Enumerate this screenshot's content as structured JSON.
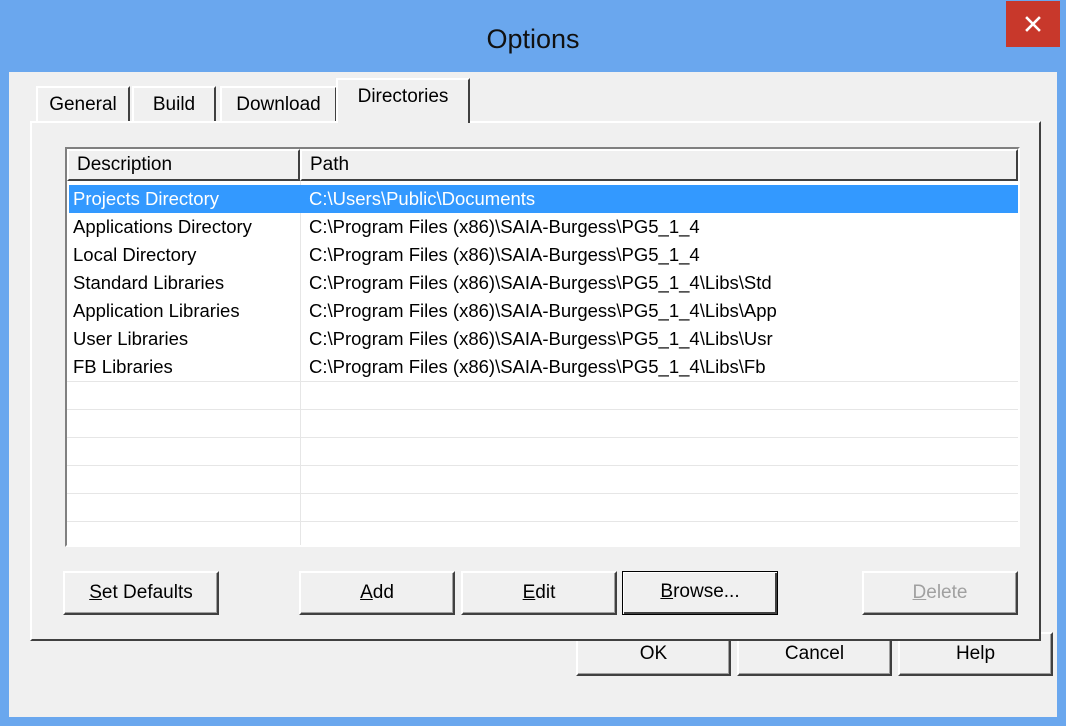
{
  "window": {
    "title": "Options"
  },
  "tabs": [
    {
      "label": "General"
    },
    {
      "label": "Build"
    },
    {
      "label": "Download"
    },
    {
      "label": "Directories",
      "active": true
    }
  ],
  "list": {
    "columns": [
      {
        "label": "Description"
      },
      {
        "label": "Path"
      }
    ],
    "rows": [
      {
        "description": "Projects Directory",
        "path": "C:\\Users\\Public\\Documents",
        "selected": true
      },
      {
        "description": "Applications Directory",
        "path": "C:\\Program Files (x86)\\SAIA-Burgess\\PG5_1_4"
      },
      {
        "description": "Local Directory",
        "path": "C:\\Program Files (x86)\\SAIA-Burgess\\PG5_1_4"
      },
      {
        "description": "Standard Libraries",
        "path": "C:\\Program Files (x86)\\SAIA-Burgess\\PG5_1_4\\Libs\\Std"
      },
      {
        "description": "Application Libraries",
        "path": "C:\\Program Files (x86)\\SAIA-Burgess\\PG5_1_4\\Libs\\App"
      },
      {
        "description": "User Libraries",
        "path": "C:\\Program Files (x86)\\SAIA-Burgess\\PG5_1_4\\Libs\\Usr"
      },
      {
        "description": "FB Libraries",
        "path": "C:\\Program Files (x86)\\SAIA-Burgess\\PG5_1_4\\Libs\\Fb"
      }
    ]
  },
  "panel_buttons": {
    "set_defaults": {
      "mnemonic": "S",
      "rest": "et Defaults"
    },
    "add": {
      "mnemonic": "A",
      "rest": "dd"
    },
    "edit": {
      "mnemonic": "E",
      "rest": "dit"
    },
    "browse": {
      "mnemonic": "B",
      "rest": "rowse..."
    },
    "delete": {
      "mnemonic": "D",
      "rest": "elete",
      "disabled": true
    }
  },
  "dialog_buttons": {
    "ok": "OK",
    "cancel": "Cancel",
    "help": "Help"
  },
  "colors": {
    "titlebar": "#6aa7ee",
    "close": "#c8382b",
    "selection": "#3399ff",
    "face": "#f0f0f0"
  },
  "icons": {
    "close": "close-icon"
  }
}
